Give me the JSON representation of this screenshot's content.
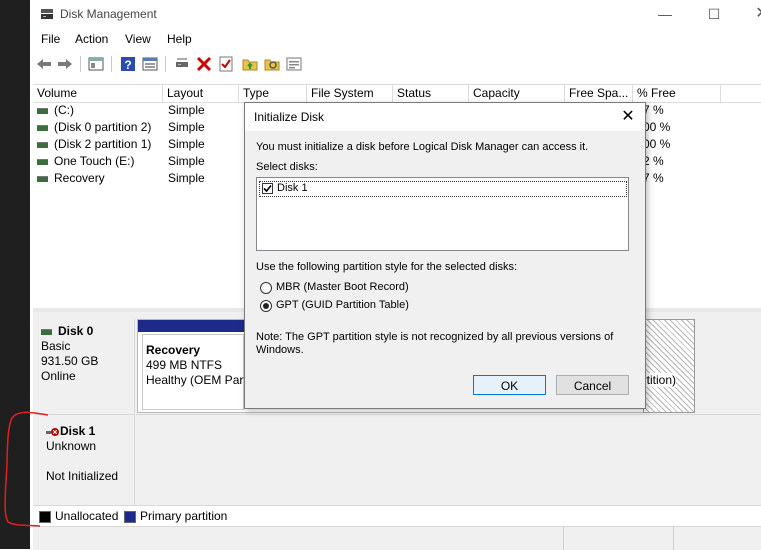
{
  "window": {
    "title": "Disk Management"
  },
  "menu": [
    "File",
    "Action",
    "View",
    "Help"
  ],
  "columns": [
    "Volume",
    "Layout",
    "Type",
    "File System",
    "Status",
    "Capacity",
    "Free Spa...",
    "% Free"
  ],
  "volumes": [
    {
      "name": "(C:)",
      "layout": "Simple",
      "free_pct": "7 %"
    },
    {
      "name": "(Disk 0 partition 2)",
      "layout": "Simple",
      "free_pct": "00 %"
    },
    {
      "name": "(Disk 2 partition 1)",
      "layout": "Simple",
      "free_pct": "00 %"
    },
    {
      "name": "One Touch (E:)",
      "layout": "Simple",
      "free_pct": "2 %"
    },
    {
      "name": "Recovery",
      "layout": "Simple",
      "free_pct": "7 %"
    }
  ],
  "disk0": {
    "name": "Disk 0",
    "type": "Basic",
    "size": "931.50 GB",
    "state": "Online",
    "partition": {
      "name": "Recovery",
      "size": "499 MB NTFS",
      "status": "Healthy (OEM Parti"
    },
    "right_fragment": "artition)"
  },
  "disk1": {
    "name": "Disk 1",
    "type": "Unknown",
    "state": "Not Initialized"
  },
  "legend": {
    "unallocated": "Unallocated",
    "primary": "Primary partition"
  },
  "colors": {
    "primary": "#1d2a89",
    "unallocated": "#000000",
    "accent": "#0078d7",
    "annotation": "#e02020"
  },
  "dialog": {
    "title": "Initialize Disk",
    "message": "You must initialize a disk before Logical Disk Manager can access it.",
    "select_label": "Select disks:",
    "disk_item": "Disk 1",
    "style_label": "Use the following partition style for the selected disks:",
    "mbr": "MBR (Master Boot Record)",
    "gpt": "GPT (GUID Partition Table)",
    "note_line1": "Note: The GPT partition style is not recognized by all previous versions of",
    "note_line2": "Windows.",
    "ok": "OK",
    "cancel": "Cancel"
  }
}
